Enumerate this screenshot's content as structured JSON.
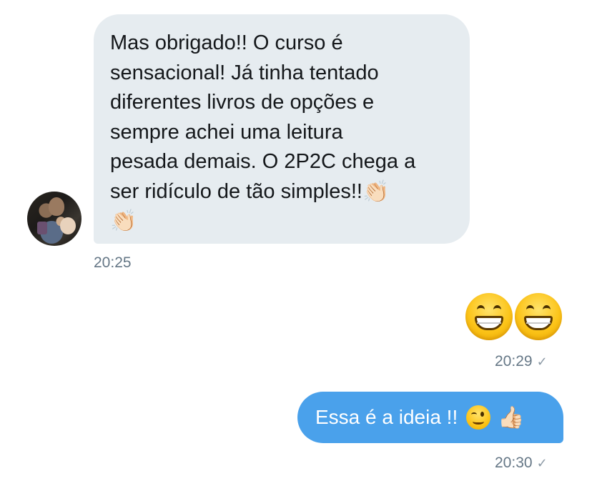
{
  "incoming_message": {
    "lines": [
      "Mas obrigado!! O curso é",
      "sensacional! Já tinha tentado",
      "diferentes livros de opções e",
      "sempre achei uma leitura",
      "pesada demais. O 2P2C chega a",
      "ser ridículo de tão simples!!"
    ],
    "emoji_inline": "👏🏻",
    "emoji_last_line": "👏🏻",
    "time": "20:25"
  },
  "outgoing_emoji_message": {
    "emojis": [
      "😄",
      "😄"
    ],
    "time": "20:29",
    "status_icon": "✓"
  },
  "outgoing_text_message": {
    "text": "Essa é a ideia !!",
    "emoji_wink": "😉",
    "emoji_thumb": "👍🏻",
    "time": "20:30",
    "status_icon": "✓"
  },
  "colors": {
    "incoming_bubble": "#e6ecf0",
    "outgoing_bubble": "#4aa1eb",
    "timestamp": "#657786"
  }
}
